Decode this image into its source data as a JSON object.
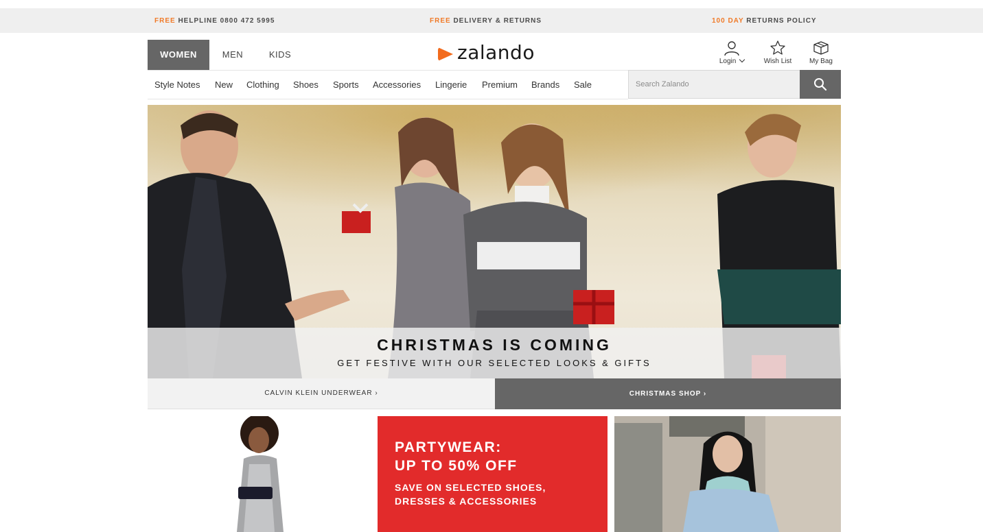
{
  "promo": {
    "helpline": {
      "highlight": "FREE",
      "text": "HELPLINE 0800 472 5995"
    },
    "delivery": {
      "highlight": "FREE",
      "text": "DELIVERY & RETURNS"
    },
    "returns": {
      "highlight": "100 DAY",
      "text": "RETURNS POLICY"
    }
  },
  "gender_tabs": [
    {
      "label": "WOMEN",
      "active": true
    },
    {
      "label": "MEN",
      "active": false
    },
    {
      "label": "KIDS",
      "active": false
    }
  ],
  "logo": {
    "text": "zalando",
    "color": "#f26b1d"
  },
  "account": {
    "login": "Login",
    "wishlist": "Wish List",
    "bag": "My Bag"
  },
  "categories": [
    "Style Notes",
    "New",
    "Clothing",
    "Shoes",
    "Sports",
    "Accessories",
    "Lingerie",
    "Premium",
    "Brands",
    "Sale"
  ],
  "search": {
    "placeholder": "Search Zalando"
  },
  "hero": {
    "headline": "CHRISTMAS IS COMING",
    "subheadline": "GET FESTIVE WITH OUR SELECTED LOOKS & GIFTS"
  },
  "cta": {
    "left": "CALVIN KLEIN UNDERWEAR",
    "right": "CHRISTMAS SHOP"
  },
  "partywear": {
    "title_line1": "PARTYWEAR:",
    "title_line2": "UP TO 50% OFF",
    "sub_line1": "SAVE ON SELECTED SHOES,",
    "sub_line2": "DRESSES & ACCESSORIES"
  },
  "colors": {
    "accent_orange": "#f07a28",
    "dark_grey": "#666666",
    "promo_red": "#e22b2b",
    "promo_bar_bg": "#efefef"
  }
}
